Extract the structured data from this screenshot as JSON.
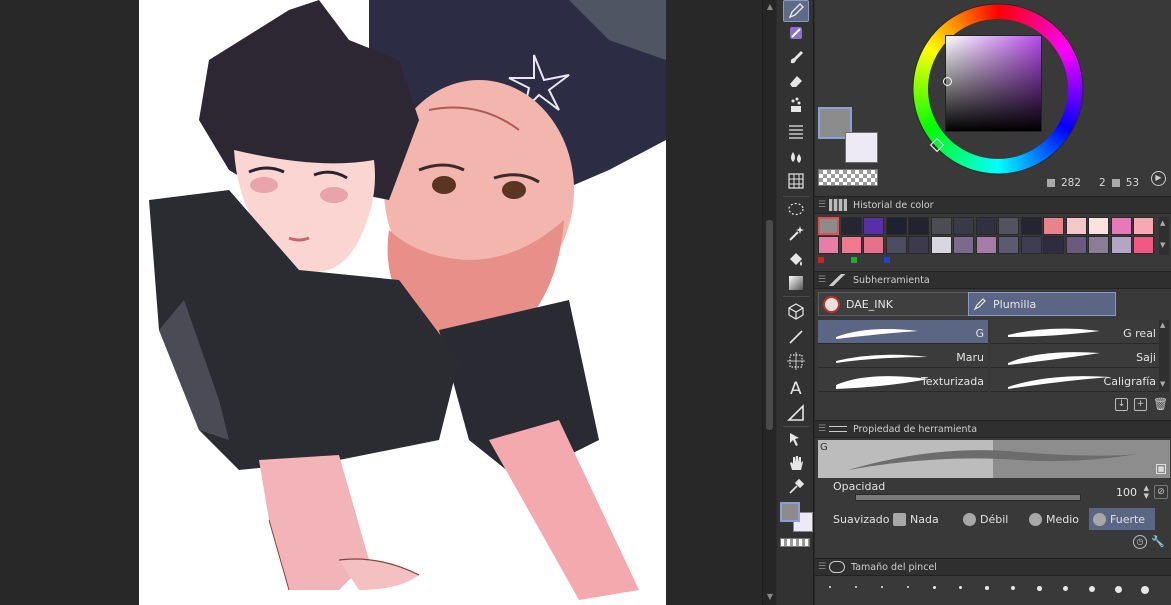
{
  "color_panel": {
    "main_color": "#8c8c8c",
    "sub_color": "#eeeaf5",
    "hue_preview": "#b64dea",
    "readout": {
      "value1": "282",
      "value2": "2",
      "value3": "53"
    }
  },
  "color_history": {
    "title": "Historial de color",
    "row1": [
      "#8c8c8c",
      "#262632",
      "#5a2ea6",
      "#1f2030",
      "#22232e",
      "#4c4c55",
      "#3a3a46",
      "#2f3040",
      "#535360",
      "#252531",
      "#e8828c",
      "#f5c8c8",
      "#fbe2dc",
      "#e67ab8",
      "#f8a8b0"
    ],
    "row2": [
      "#e87ea8",
      "#f07890",
      "#e6708c",
      "#4d4b5e",
      "#3c3a4c",
      "#d9d6df",
      "#7a6a8c",
      "#a57ca6",
      "#5c5a70",
      "#3e3d52",
      "#2e2c3e",
      "#6a5a7e",
      "#8a7d96",
      "#b2a6c4",
      "#f05a82"
    ],
    "markers": [
      "#cc2222",
      "#22aa33",
      "#2244cc"
    ]
  },
  "subtool": {
    "title": "Subherramienta",
    "groups": [
      "DAE_INK",
      "Plumilla"
    ],
    "brushes": [
      "G",
      "G real",
      "Maru",
      "Saji",
      "Texturizada",
      "Caligrafía"
    ]
  },
  "tool_property": {
    "title": "Propiedad de herramienta",
    "preview_label": "G",
    "opacity_label": "Opacidad",
    "opacity_value": "100",
    "opacity_level": 1.0,
    "smoothing_label": "Suavizado",
    "smoothing_options": [
      "Nada",
      "Débil",
      "Medio",
      "Fuerte"
    ],
    "smoothing_selected": "Fuerte"
  },
  "brush_size": {
    "title": "Tamaño del pincel"
  }
}
